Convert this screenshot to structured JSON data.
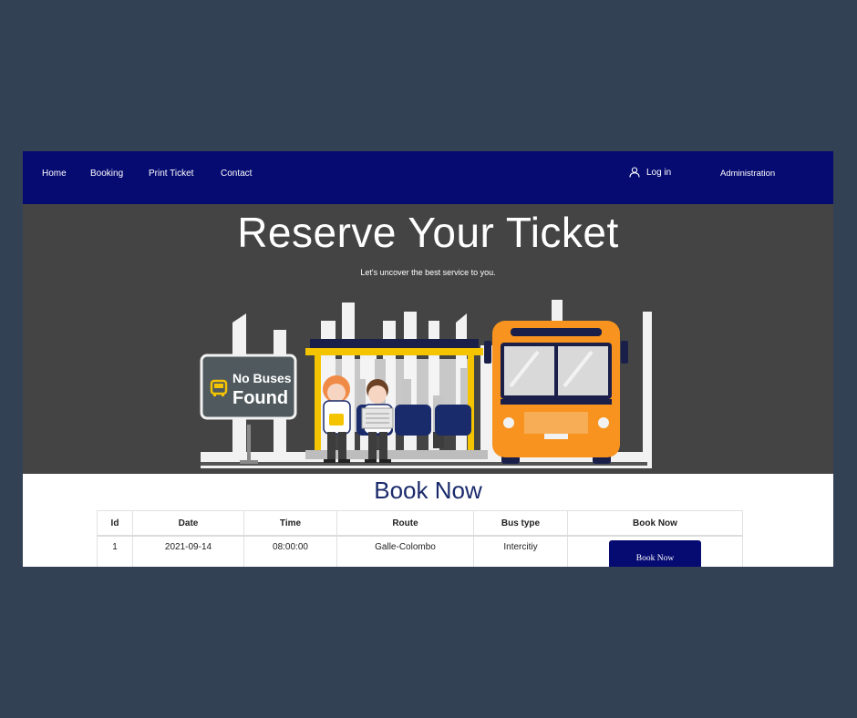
{
  "nav": {
    "links": [
      "Home",
      "Booking",
      "Print Ticket",
      "Contact"
    ],
    "login_label": "Log in",
    "admin_label": "Administration"
  },
  "hero": {
    "title": "Reserve Your Ticket",
    "subtitle": "Let's uncover the best service to you.",
    "sign_line1": "No Buses",
    "sign_line2": "Found"
  },
  "book": {
    "title": "Book Now",
    "columns": [
      "Id",
      "Date",
      "Time",
      "Route",
      "Bus type",
      "Book Now"
    ],
    "rows": [
      {
        "id": "1",
        "date": "2021-09-14",
        "time": "08:00:00",
        "route": "Galle-Colombo",
        "bus_type": "Intercitiy",
        "button": "Book Now"
      }
    ]
  },
  "colors": {
    "page_bg": "#334155",
    "nav_bg": "#060b72",
    "hero_bg": "#444444",
    "bus": "#f7931e",
    "shelter": "#f5c400",
    "sign_bg": "#505a5e"
  },
  "icons": {
    "login": "user-icon",
    "sign": "bus-icon"
  }
}
